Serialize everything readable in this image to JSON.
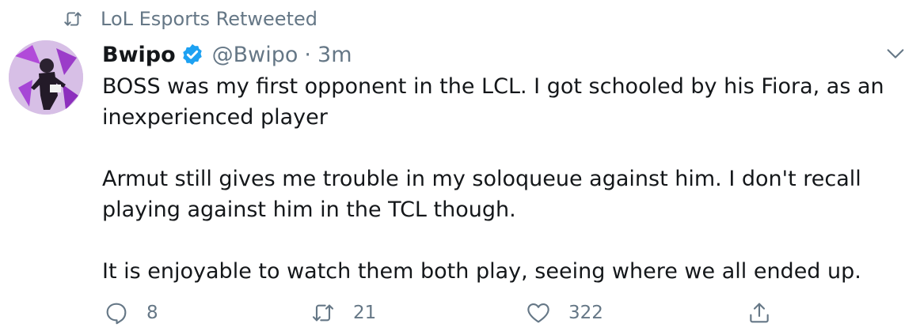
{
  "social_context": {
    "text": "LoL Esports Retweeted",
    "icon": "retweet-icon"
  },
  "author": {
    "display_name": "Bwipo",
    "verified": true,
    "handle": "@Bwipo",
    "separator": "·",
    "timestamp": "3m"
  },
  "tweet": {
    "paragraphs": [
      "BOSS was my first opponent in the LCL. I got schooled by his Fiora, as an inexperienced player",
      "Armut still gives me trouble in my soloqueue against him. I don't recall playing against him in the TCL though.",
      "It is enjoyable to watch them both play, seeing where we all ended up."
    ]
  },
  "actions": {
    "reply": {
      "icon": "reply-icon",
      "count": "8"
    },
    "retweet": {
      "icon": "retweet-icon",
      "count": "21"
    },
    "like": {
      "icon": "heart-icon",
      "count": "322"
    },
    "share": {
      "icon": "share-icon"
    }
  },
  "colors": {
    "text": "#14171a",
    "secondary": "#657786",
    "verified_blue": "#1da1f2",
    "background": "#ffffff"
  }
}
